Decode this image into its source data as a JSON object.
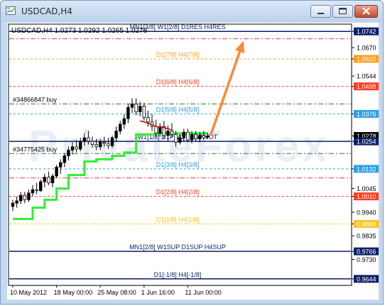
{
  "window": {
    "title": "USDCAD,H4"
  },
  "icons": {
    "app": "chart-app-icon",
    "minimize": "minimize-icon",
    "maximize": "maximize-icon",
    "close": "close-icon"
  },
  "chart_header": {
    "text": "USDCAD,H4  1.0273 1.0292 1.0265 1.0278"
  },
  "watermark": "PrivateForex",
  "colors": {
    "background": "#ffffff",
    "frame": "#c6d8ee",
    "candles": "#000000",
    "support_line": "#33ee33",
    "arrow": "#ff8833",
    "current_price_box": "#000000",
    "red_line": "#cc0000"
  },
  "chart_data": {
    "type": "candlestick",
    "symbol": "USDCAD",
    "timeframe": "H4",
    "ohlc_last": {
      "open": 1.0273,
      "high": 1.0292,
      "low": 1.0265,
      "close": 1.0278
    },
    "ylim": [
      0.9615,
      1.0771
    ],
    "y_ticks": [
      {
        "value": 1.0742,
        "label": "1.0742",
        "highlight": "#0a1f66"
      },
      {
        "value": 1.067,
        "label": "1.0670"
      },
      {
        "value": 1.062,
        "label": "1.0620",
        "highlight": "#ff9e1a"
      },
      {
        "value": 1.0544,
        "label": "1.0544"
      },
      {
        "value": 1.0498,
        "label": "1.0498",
        "highlight": "#ff3c1f"
      },
      {
        "value": 1.0376,
        "label": "1.0376",
        "highlight": "#2e9ee8"
      },
      {
        "value": 1.0278,
        "label": "1.0278",
        "highlight": "#000000"
      },
      {
        "value": 1.0254,
        "label": "1.0254",
        "highlight": "#0a1f66"
      },
      {
        "value": 1.0132,
        "label": "1.0132",
        "highlight": "#2e9ee8"
      },
      {
        "value": 1.0045,
        "label": "1.0045"
      },
      {
        "value": 1.001,
        "label": "1.0010",
        "highlight": "#ff3c1f"
      },
      {
        "value": 0.994,
        "label": "0.9940"
      },
      {
        "value": 0.9888,
        "label": "0.9888",
        "highlight": "#ffc21a"
      },
      {
        "value": 0.9835,
        "label": "0.9835"
      },
      {
        "value": 0.9766,
        "label": "0.9766",
        "highlight": "#0a1f66"
      },
      {
        "value": 0.973,
        "label": "0.9730"
      },
      {
        "value": 0.9644,
        "label": "0.9644",
        "highlight": "#0a1f66"
      }
    ],
    "x_ticks": [
      {
        "label": "10 May 2012",
        "i": 0
      },
      {
        "label": "18 May 00:00",
        "i": 11
      },
      {
        "label": "25 May 08:00",
        "i": 22
      },
      {
        "label": "1 Jun 16:00",
        "i": 33
      },
      {
        "label": "11 Jun 00:00",
        "i": 44
      }
    ],
    "levels": [
      {
        "value": 1.0742,
        "label": "MN1[3/8] W1[2/8] D1RES H4RES",
        "color": "#0a1f66",
        "style": "solid",
        "label_color": "#0a1f66"
      },
      {
        "value": 1.0709,
        "label": "",
        "color": "#e04040",
        "style": "dashdot",
        "label_color": "#e04040"
      },
      {
        "value": 1.062,
        "label": "D1[7/8] H4[7/8]",
        "color": "#ff9e1a",
        "style": "dotted",
        "label_color": "#ff9e1a"
      },
      {
        "value": 1.0498,
        "label": "D1[6/8] H4[6/8]",
        "color": "#ff3c1f",
        "style": "dotted",
        "label_color": "#ff3c1f"
      },
      {
        "value": 1.042,
        "label": "#34866847 buy",
        "color": "#2a7a2a",
        "style": "dashdot",
        "label_color": "#000000"
      },
      {
        "value": 1.0376,
        "label": "D1[5/8] H4[5/8]",
        "color": "#2e9ee8",
        "style": "dotted",
        "label_color": "#2e9ee8"
      },
      {
        "value": 1.0254,
        "label": "W1[1/8] D1PIVOT H4PIVOT",
        "color": "#0a1f66",
        "style": "solid",
        "label_color": "#0a1f66"
      },
      {
        "value": 1.02,
        "label": "#34775425 buy",
        "color": "#2a7a2a",
        "style": "dashdot",
        "label_color": "#000000"
      },
      {
        "value": 1.0132,
        "label": "D1[3/8] H4[3/8]",
        "color": "#2e9ee8",
        "style": "dotted",
        "label_color": "#2e9ee8"
      },
      {
        "value": 1.0092,
        "label": "",
        "color": "#e04040",
        "style": "dashdot",
        "label_color": "#e04040"
      },
      {
        "value": 1.001,
        "label": "D1[2/8] H4[2/8]",
        "color": "#ff3c1f",
        "style": "dotted",
        "label_color": "#ff3c1f"
      },
      {
        "value": 0.9888,
        "label": "D1[1/8] H4[1/8]",
        "color": "#ffc21a",
        "style": "dotted",
        "label_color": "#ffc21a"
      },
      {
        "value": 0.9766,
        "label": "MN1[2/8] W1SUP D1SUP H4SUP",
        "color": "#0a1f66",
        "style": "solid",
        "label_color": "#0a1f66"
      },
      {
        "value": 0.9644,
        "label": "D1[-1/8] H4[-1/8]",
        "color": "#0a1f66",
        "style": "solid",
        "label_color": "#0a1f66"
      }
    ],
    "candles": [
      [
        0.9965,
        0.9995,
        0.9945,
        0.998
      ],
      [
        0.998,
        1.001,
        0.996,
        0.999
      ],
      [
        0.999,
        1.003,
        0.9975,
        1.0015
      ],
      [
        1.0015,
        1.003,
        0.998,
        0.9995
      ],
      [
        0.9995,
        1.004,
        0.9985,
        1.0025
      ],
      [
        1.0025,
        1.006,
        1.001,
        1.004
      ],
      [
        1.004,
        1.007,
        1.002,
        1.0035
      ],
      [
        1.0035,
        1.0085,
        1.003,
        1.0075
      ],
      [
        1.0075,
        1.011,
        1.005,
        1.0095
      ],
      [
        1.0095,
        1.012,
        1.006,
        1.007
      ],
      [
        1.007,
        1.011,
        1.005,
        1.01
      ],
      [
        1.01,
        1.015,
        1.009,
        1.014
      ],
      [
        1.014,
        1.0175,
        1.011,
        1.016
      ],
      [
        1.016,
        1.02,
        1.014,
        1.019
      ],
      [
        1.019,
        1.023,
        1.017,
        1.0215
      ],
      [
        1.0215,
        1.025,
        1.0195,
        1.023
      ],
      [
        1.023,
        1.026,
        1.0205,
        1.022
      ],
      [
        1.022,
        1.027,
        1.021,
        1.0255
      ],
      [
        1.0255,
        1.029,
        1.0235,
        1.027
      ],
      [
        1.027,
        1.03,
        1.024,
        1.0255
      ],
      [
        1.0255,
        1.0275,
        1.0225,
        1.024
      ],
      [
        1.024,
        1.0265,
        1.0215,
        1.023
      ],
      [
        1.023,
        1.0265,
        1.0215,
        1.025
      ],
      [
        1.025,
        1.0275,
        1.023,
        1.0245
      ],
      [
        1.0245,
        1.027,
        1.022,
        1.0235
      ],
      [
        1.0235,
        1.028,
        1.0225,
        1.027
      ],
      [
        1.027,
        1.032,
        1.0255,
        1.03
      ],
      [
        1.03,
        1.0345,
        1.0285,
        1.033
      ],
      [
        1.033,
        1.0375,
        1.031,
        1.0355
      ],
      [
        1.0355,
        1.042,
        1.0335,
        1.0405
      ],
      [
        1.0405,
        1.0445,
        1.038,
        1.042
      ],
      [
        1.042,
        1.0445,
        1.037,
        1.0385
      ],
      [
        1.0385,
        1.043,
        1.0365,
        1.041
      ],
      [
        1.041,
        1.0425,
        1.0345,
        1.036
      ],
      [
        1.036,
        1.039,
        1.032,
        1.034
      ],
      [
        1.034,
        1.0375,
        1.03,
        1.032
      ],
      [
        1.032,
        1.035,
        1.0275,
        1.029
      ],
      [
        1.029,
        1.0335,
        1.0275,
        1.032
      ],
      [
        1.032,
        1.0345,
        1.0265,
        1.028
      ],
      [
        1.028,
        1.0325,
        1.0255,
        1.03
      ],
      [
        1.03,
        1.0335,
        1.027,
        1.0285
      ],
      [
        1.0285,
        1.03,
        1.023,
        1.025
      ],
      [
        1.025,
        1.0285,
        1.024,
        1.027
      ],
      [
        1.027,
        1.031,
        1.0255,
        1.0295
      ],
      [
        1.0295,
        1.031,
        1.025,
        1.026
      ],
      [
        1.026,
        1.03,
        1.0245,
        1.0285
      ],
      [
        1.0285,
        1.03,
        1.0255,
        1.0265
      ],
      [
        1.0265,
        1.0295,
        1.025,
        1.028
      ],
      [
        1.028,
        1.03,
        1.026,
        1.027
      ],
      [
        1.0273,
        1.0292,
        1.0265,
        1.0278
      ]
    ],
    "support_steps": [
      [
        0,
        0.991
      ],
      [
        5,
        0.991
      ],
      [
        5,
        0.996
      ],
      [
        8,
        0.996
      ],
      [
        8,
        0.9995
      ],
      [
        11,
        0.9995
      ],
      [
        11,
        1.0045
      ],
      [
        14,
        1.0045
      ],
      [
        14,
        1.0105
      ],
      [
        18,
        1.0105
      ],
      [
        18,
        1.0165
      ],
      [
        21,
        1.0165
      ],
      [
        21,
        1.0175
      ],
      [
        25,
        1.0175
      ],
      [
        25,
        1.019
      ],
      [
        28,
        1.019
      ],
      [
        28,
        1.0205
      ],
      [
        31,
        1.0205
      ],
      [
        31,
        1.0285
      ],
      [
        36,
        1.0285
      ],
      [
        36,
        1.029
      ],
      [
        49,
        1.029
      ]
    ],
    "red_segment": [
      [
        32,
        1.0345
      ],
      [
        34,
        1.0335
      ],
      [
        36,
        1.032
      ],
      [
        38,
        1.0315
      ],
      [
        40,
        1.0305
      ]
    ],
    "arrow": {
      "from": [
        49,
        1.028
      ],
      "to": [
        58,
        1.07
      ]
    }
  }
}
